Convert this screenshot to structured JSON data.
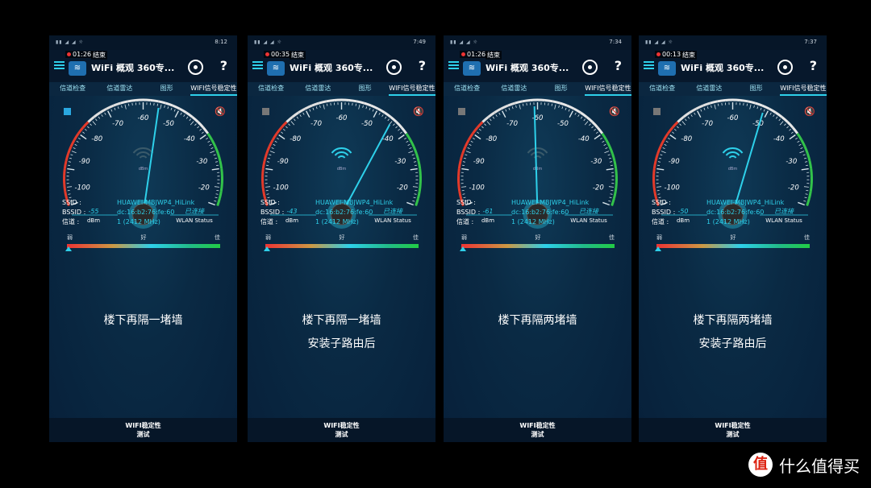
{
  "phones": [
    {
      "time": "8:12",
      "timer": "01:26",
      "end_label": "结束",
      "title": "WiFi 概观 360专...",
      "tabs": [
        "信道检查",
        "信道雷达",
        "图形",
        "WIFI信号稳定性"
      ],
      "dbm_value": "-55",
      "dbm_unit": "dBm",
      "status_value": "已连接",
      "status_label": "WLAN Status",
      "ssid_k": "SSID :",
      "ssid": "HUAWEI-MBJWP4_HiLink",
      "bssid_k": "BSSID :",
      "bssid": "dc:16:b2:76:fe:60",
      "ch_k": "信道 :",
      "channel": "1 (2412 MHz)",
      "scale": [
        "弱",
        "好",
        "佳"
      ],
      "caption1": "楼下再隔一堵墙",
      "caption2": "",
      "bottom1": "WIFI稳定性",
      "bottom2": "测试",
      "reading": -55,
      "marker": 0.01,
      "square_color": "#2aa8e0"
    },
    {
      "time": "7:49",
      "timer": "00:35",
      "end_label": "结束",
      "title": "WiFi 概观 360专...",
      "tabs": [
        "信道检查",
        "信道雷达",
        "图形",
        "WIFI信号稳定性"
      ],
      "dbm_value": "-43",
      "dbm_unit": "dBm",
      "status_value": "已连接",
      "status_label": "WLAN Status",
      "ssid_k": "SSID :",
      "ssid": "HUAWEI-MBJWP4_HiLink",
      "bssid_k": "BSSID :",
      "bssid": "dc:16:b2:76:fe:60",
      "ch_k": "信道 :",
      "channel": "1 (2412 MHz)",
      "scale": [
        "弱",
        "好",
        "佳"
      ],
      "caption1": "楼下再隔一堵墙",
      "caption2": "安装子路由后",
      "bottom1": "WIFI稳定性",
      "bottom2": "测试",
      "reading": -43,
      "marker": 0.01,
      "square_color": "#777"
    },
    {
      "time": "7:34",
      "timer": "01:26",
      "end_label": "结束",
      "title": "WiFi 概观 360专...",
      "tabs": [
        "信道检查",
        "信道雷达",
        "图形",
        "WIFI信号稳定性"
      ],
      "dbm_value": "-61",
      "dbm_unit": "dBm",
      "status_value": "已连接",
      "status_label": "WLAN Status",
      "ssid_k": "SSID :",
      "ssid": "HUAWEI-MBJWP4_HiLink",
      "bssid_k": "BSSID :",
      "bssid": "dc:16:b2:76:fe:60",
      "ch_k": "信道 :",
      "channel": "1 (2412 MHz)",
      "scale": [
        "弱",
        "好",
        "佳"
      ],
      "caption1": "楼下再隔两堵墙",
      "caption2": "",
      "bottom1": "WIFI稳定性",
      "bottom2": "测试",
      "reading": -61,
      "marker": 0.01,
      "square_color": "#777"
    },
    {
      "time": "7:37",
      "timer": "00:13",
      "end_label": "结束",
      "title": "WiFi 概观 360专...",
      "tabs": [
        "信道检查",
        "信道雷达",
        "图形",
        "WIFI信号稳定性"
      ],
      "dbm_value": "-50",
      "dbm_unit": "dBm",
      "status_value": "已连接",
      "status_label": "WLAN Status",
      "ssid_k": "SSID :",
      "ssid": "HUAWEI-MBJWP4_HiLink",
      "bssid_k": "BSSID :",
      "bssid": "dc:16:b2:76:fe:60",
      "ch_k": "信道 :",
      "channel": "1 (2412 MHz)",
      "scale": [
        "弱",
        "好",
        "佳"
      ],
      "caption1": "楼下再隔两堵墙",
      "caption2": "安装子路由后",
      "bottom1": "WIFI稳定性",
      "bottom2": "测试",
      "reading": -50,
      "marker": 0.01,
      "square_color": "#777"
    }
  ],
  "gauge_ticks": [
    "-100",
    "-90",
    "-80",
    "-70",
    "-60",
    "-50",
    "-40",
    "-30",
    "-20"
  ],
  "gauge_center_label": "dBm",
  "brand": {
    "logo": "值",
    "text": "什么值得买"
  }
}
